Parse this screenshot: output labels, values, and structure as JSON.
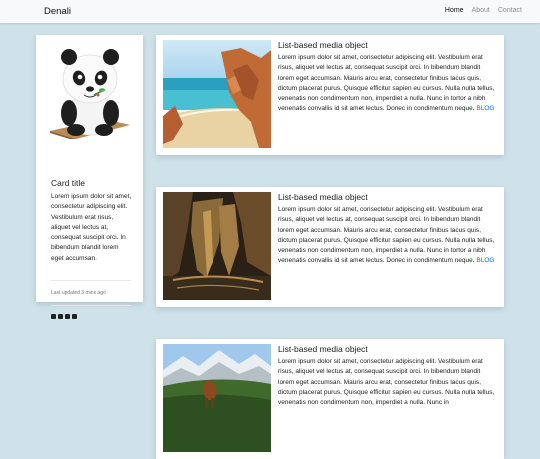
{
  "navbar": {
    "brand": "Denali",
    "links": [
      {
        "label": "Home"
      },
      {
        "label": "About"
      },
      {
        "label": "Contact"
      }
    ]
  },
  "profile_card": {
    "title": "Card title",
    "text": "Lorem ipsum dolor sit amet, consectetur adipiscing elit. Vestibulum erat risus, aliquet vel lectus at, consequat suscipit orci. In bibendum blandit lorem eget accumsan.",
    "updated": "Last updated 3 mins ago",
    "social_icons": [
      "facebook-icon",
      "linkedin-icon",
      "twitter-icon",
      "instagram-icon"
    ]
  },
  "media_items": [
    {
      "title": "List-based media object",
      "text": "Lorem ipsum dolor sit amet, consectetur adipiscing elit. Vestibulum erat risus, aliquet vel lectus at, consequat suscipit orci. In bibendum blandit lorem eget accumsan. Mauris arcu erat, consectetur finibus lacus quis, dictum placerat purus. Quisque efficitur sapien eu cursus. Nulla nulla tellus, venenatis non condimentum non, imperdiet a nulla. Nunc in tortor a nibh venenatis convallis id sit amet lectus. Donec in condimentum neque.",
      "link": "BLOG",
      "image": "beach-photo"
    },
    {
      "title": "List-based media object",
      "text": "Lorem ipsum dolor sit amet, consectetur adipiscing elit. Vestibulum erat risus, aliquet vel lectus at, consequat suscipit orci. In bibendum blandit lorem eget accumsan. Mauris arcu erat, consectetur finibus lacus quis, dictum placerat purus. Quisque efficitur sapien eu cursus. Nulla nulla tellus, venenatis non condimentum non, imperdiet a nulla. Nunc in tortor a nibh venenatis convallis id sit amet lectus. Donec in condimentum neque.",
      "link": "BLOG",
      "image": "cave-photo"
    },
    {
      "title": "List-based media object",
      "text": "Lorem ipsum dolor sit amet, consectetur adipiscing elit. Vestibulum erat risus, aliquet vel lectus at, consequat suscipit orci. In bibendum blandit lorem eget accumsan. Mauris arcu erat, consectetur finibus lacus quis, dictum placerat purus. Quisque efficitur sapien eu cursus. Nulla nulla tellus, venenatis non condimentum non, imperdiet a nulla. Nunc in",
      "link": "",
      "image": "mountain-horse-photo"
    }
  ],
  "colors": {
    "background": "#cfe2ea",
    "navbar": "#f8f9fa",
    "link": "#0d6efd"
  }
}
